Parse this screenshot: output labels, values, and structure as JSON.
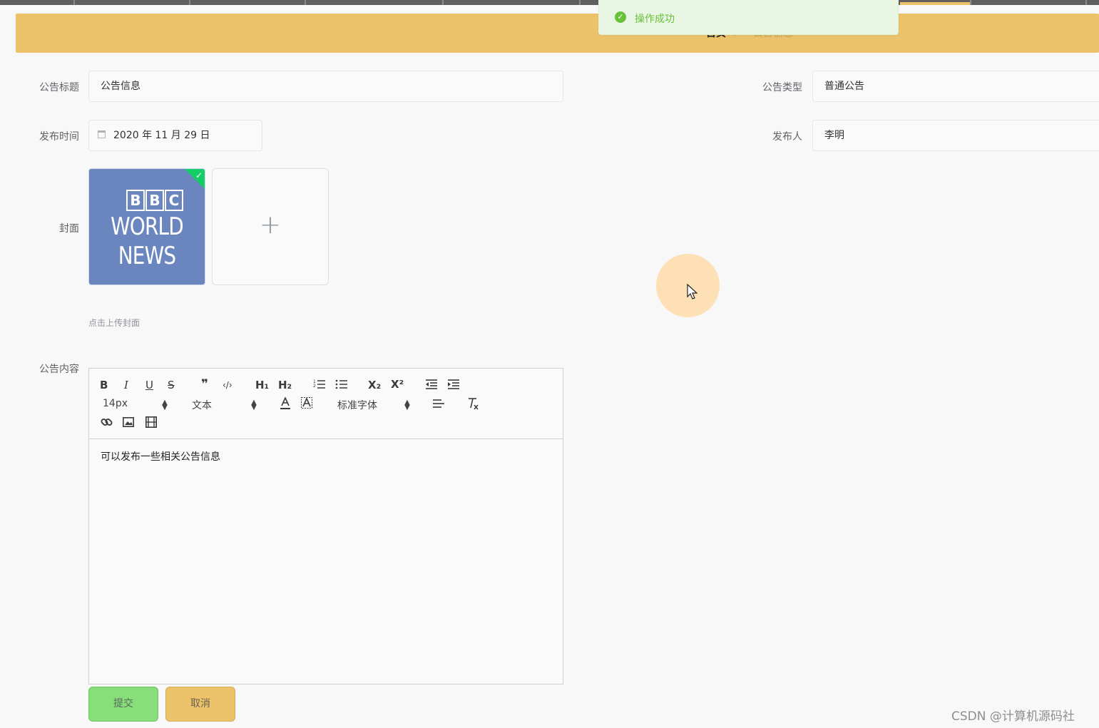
{
  "toast": {
    "message": "操作成功",
    "icon": "check-circle-icon"
  },
  "breadcrumb": {
    "home": "首页",
    "separator": "/",
    "current": "公告信息"
  },
  "form": {
    "title_label": "公告标题",
    "title_value": "公告信息",
    "type_label": "公告类型",
    "type_value": "普通公告",
    "date_label": "发布时间",
    "date_value": "2020 年 11 月 29 日",
    "publisher_label": "发布人",
    "publisher_value": "李明",
    "cover_label": "封面",
    "cover_image": {
      "line0": [
        "B",
        "B",
        "C"
      ],
      "line1": "WORLD",
      "line2": "NEWS"
    },
    "cover_add": "+",
    "cover_tip": "点击上传封面",
    "content_label": "公告内容",
    "content_text": "可以发布一些相关公告信息"
  },
  "editor_toolbar": {
    "row1": [
      "B",
      "I",
      "U",
      "S",
      "❞",
      "‹/›",
      "H₁",
      "H₂",
      "⅟",
      "☰",
      "X₂",
      "X²",
      "⇤",
      "⇥"
    ],
    "size_value": "14px",
    "header_value": "文本",
    "font_value": "标准字体"
  },
  "buttons": {
    "submit": "提交",
    "cancel": "取消"
  },
  "watermark": "CSDN @计算机源码社",
  "colors": {
    "banner": "#ecc36a",
    "submit": "#87de7b",
    "toast_text": "#67c23a"
  }
}
